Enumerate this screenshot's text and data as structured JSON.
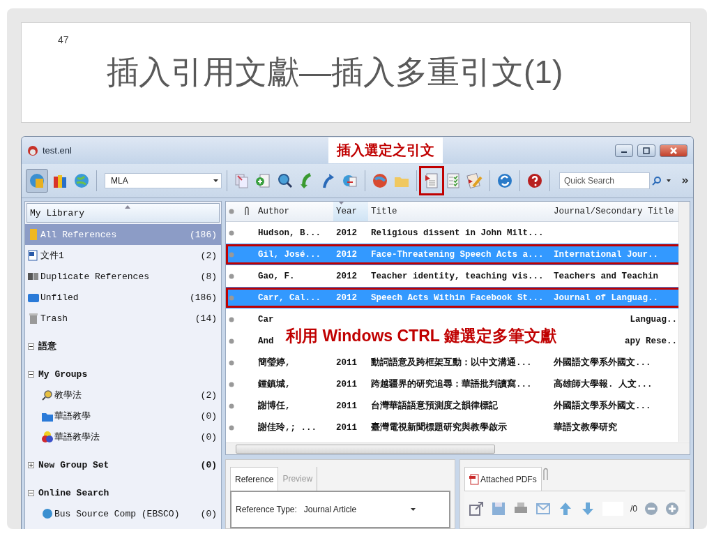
{
  "slide": {
    "page_number": "47",
    "title": "插入引用文獻—插入多重引文(1)"
  },
  "callouts": [
    {
      "text": "插入選定之引文"
    },
    {
      "text": "利用 Windows CTRL 鍵選定多筆文獻"
    }
  ],
  "window": {
    "title": "test.enl"
  },
  "toolbar": {
    "style": "MLA",
    "search": {
      "placeholder": "Quick Search"
    }
  },
  "sidebar": {
    "header": "My Library",
    "items": [
      {
        "kind": "item",
        "label": "All References",
        "count": "(186)",
        "selected": true
      },
      {
        "kind": "item",
        "label": "文件1",
        "count": "(2)",
        "selected": false
      },
      {
        "kind": "item",
        "label": "Duplicate References",
        "count": "(8)",
        "selected": false
      },
      {
        "kind": "item",
        "label": "Unfiled",
        "count": "(186)",
        "selected": false
      },
      {
        "kind": "item",
        "label": "Trash",
        "count": "(14)",
        "selected": false
      },
      {
        "kind": "group",
        "label": "語意",
        "expanded": true,
        "selected": false
      },
      {
        "kind": "group",
        "label": "My Groups",
        "expanded": true,
        "selected": false,
        "children": [
          {
            "kind": "item",
            "label": "教學法",
            "count": "(2)",
            "selected": false
          },
          {
            "kind": "item",
            "label": "華語教學",
            "count": "(0)",
            "selected": false
          },
          {
            "kind": "item",
            "label": "華語教學法",
            "count": "(0)",
            "selected": false
          }
        ]
      },
      {
        "kind": "group",
        "label": "New Group Set",
        "count": "(0)",
        "expanded": false,
        "selected": false
      },
      {
        "kind": "group",
        "label": "Online Search",
        "expanded": true,
        "selected": false,
        "children": [
          {
            "kind": "item",
            "label": "Bus Source Comp (EBSCO)",
            "count": "(0)",
            "selected": false
          }
        ]
      }
    ]
  },
  "table": {
    "columns": [
      {
        "label": "Author",
        "sorted": false
      },
      {
        "label": "Year",
        "sorted": true
      },
      {
        "label": "Title",
        "sorted": false
      },
      {
        "label": "Journal/Secondary Title",
        "sorted": false
      }
    ],
    "rows": [
      {
        "selected": false,
        "author": "Hudson, B...",
        "year": "2012",
        "title": "Religious dissent in John Milt..."
      },
      {
        "selected": true,
        "author": "Gil, José...",
        "year": "2012",
        "title": "Face-Threatening Speech Acts a...",
        "journal": "International Jour.."
      },
      {
        "selected": false,
        "author": "Gao, F.",
        "year": "2012",
        "title": "Teacher identity, teaching vis...",
        "journal": "Teachers and Teachin"
      },
      {
        "selected": true,
        "author": "Carr, Cal...",
        "year": "2012",
        "title": "Speech Acts Within Facebook St...",
        "journal": "Journal of Languag.."
      },
      {
        "selected": false,
        "author": "Car",
        "journal": "Languag.."
      },
      {
        "selected": false,
        "author": "And",
        "journal": "apy Rese.."
      },
      {
        "selected": false,
        "author": "簡瑩婷,",
        "year": "2011",
        "title": "動詞語意及跨框架互動：以中文溝通...",
        "journal": "外國語文學系外國文..."
      },
      {
        "selected": false,
        "author": "鍾鎮城,",
        "year": "2011",
        "title": "跨越疆界的研究追尋：華語批判讀寫...",
        "journal": "高雄師大學報. 人文..."
      },
      {
        "selected": false,
        "author": "謝博任,",
        "year": "2011",
        "title": "台灣華語語意預測度之韻律標記",
        "journal": "外國語文學系外國文..."
      },
      {
        "selected": false,
        "author": "謝佳玲,; ...",
        "year": "2011",
        "title": "臺灣電視新聞標題研究與教學啟示",
        "journal": "華語文教學研究"
      }
    ]
  },
  "reference_pane": {
    "tabs": [
      {
        "label": "Reference",
        "selected": true
      },
      {
        "label": "Preview",
        "selected": false
      }
    ],
    "field_label": "Reference Type:",
    "field_value": "Journal Article"
  },
  "pdf_pane": {
    "tab": "Attached PDFs",
    "page_count": "/0"
  }
}
